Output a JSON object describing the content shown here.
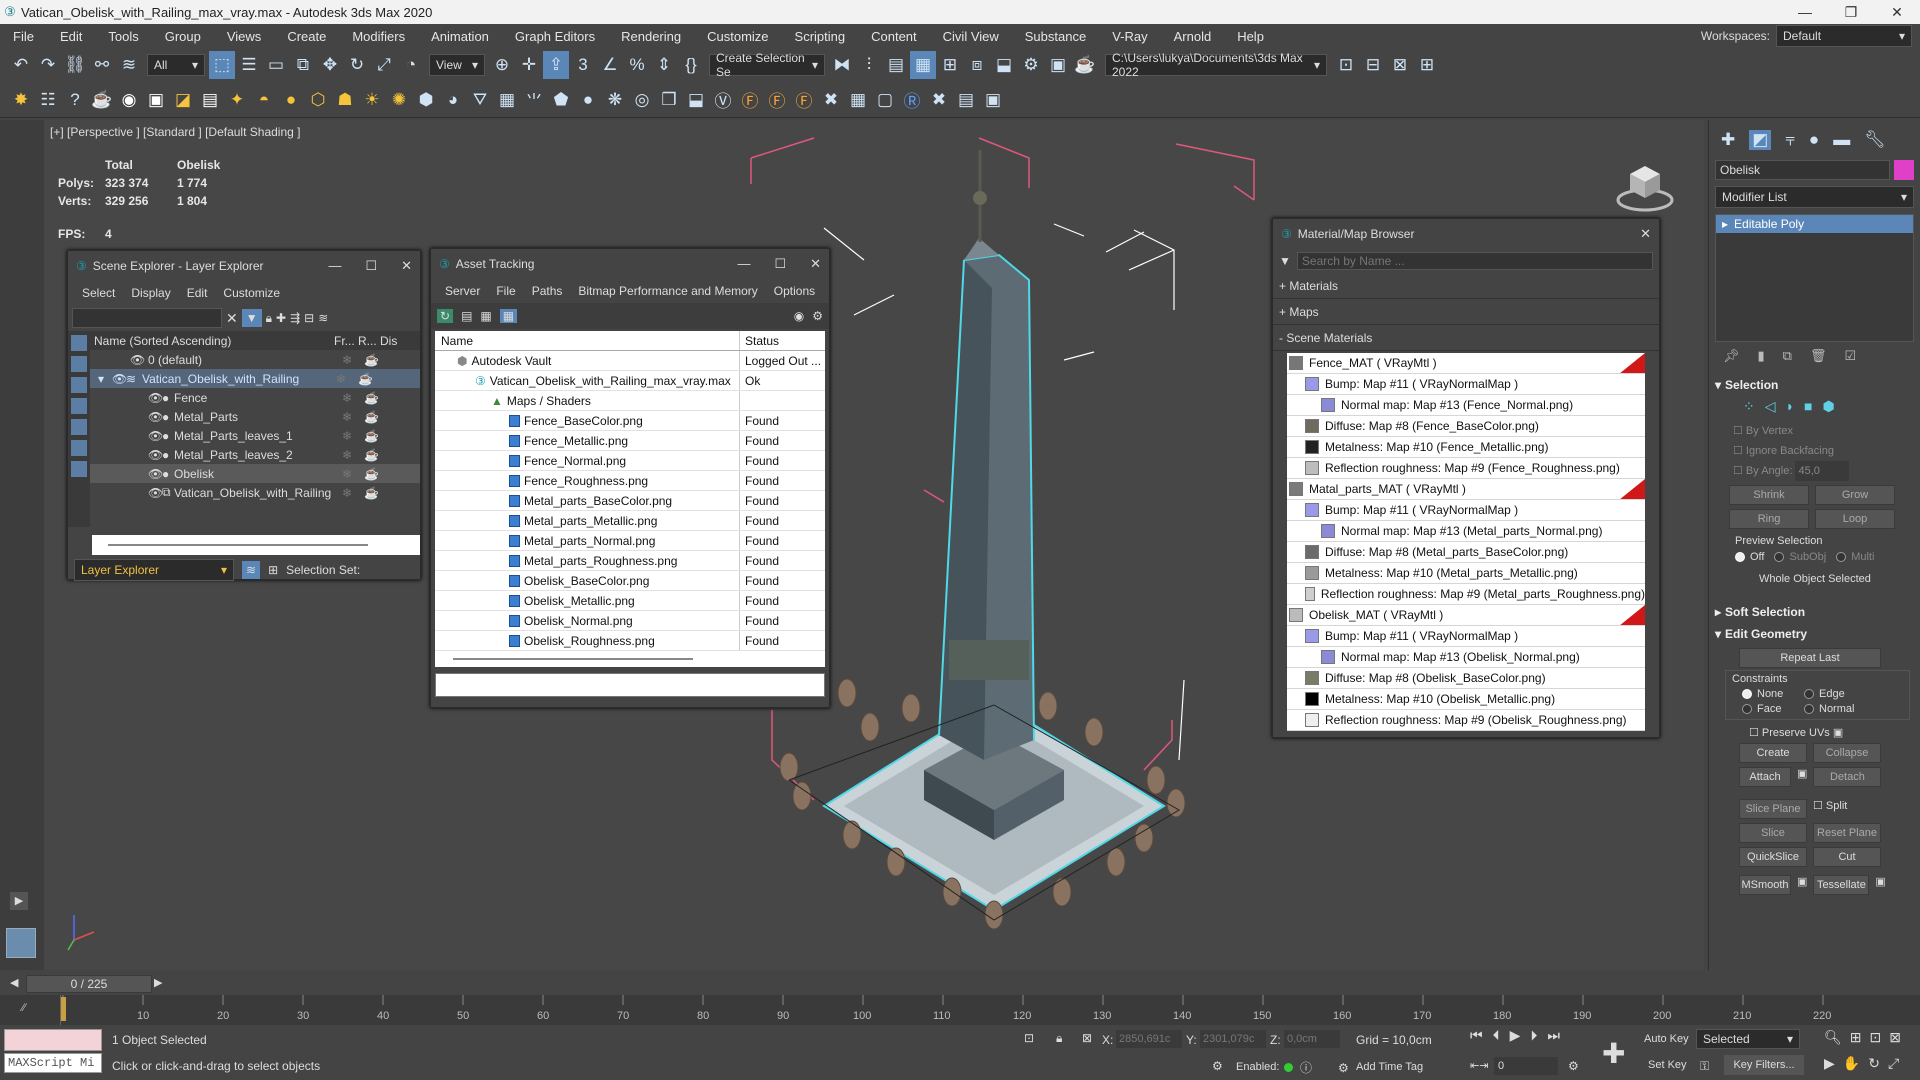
{
  "window": {
    "title": "Vatican_Obelisk_with_Railing_max_vray.max - Autodesk 3ds Max 2020",
    "workspace_label": "Workspaces:",
    "workspace_value": "Default"
  },
  "menu": [
    "File",
    "Edit",
    "Tools",
    "Group",
    "Views",
    "Create",
    "Modifiers",
    "Animation",
    "Graph Editors",
    "Rendering",
    "Customize",
    "Scripting",
    "Content",
    "Civil View",
    "Substance",
    "V-Ray",
    "Arnold",
    "Help"
  ],
  "toolbar": {
    "filter": "All",
    "ref_coord": "View",
    "selection_set": "Create Selection Se",
    "project_path": "C:\\Users\\lukya\\Documents\\3ds Max 2022"
  },
  "viewport": {
    "label": "[+] [Perspective ] [Standard ] [Default Shading ]",
    "stats": {
      "h_total": "Total",
      "h_obj": "Obelisk",
      "polys_label": "Polys:",
      "polys_total": "323 374",
      "polys_obj": "1 774",
      "verts_label": "Verts:",
      "verts_total": "329 256",
      "verts_obj": "1 804",
      "fps_label": "FPS:",
      "fps_value": "4"
    }
  },
  "scene_explorer": {
    "title": "Scene Explorer - Layer Explorer",
    "menu": [
      "Select",
      "Display",
      "Edit",
      "Customize"
    ],
    "col_name": "Name (Sorted Ascending)",
    "col_fr": "Fr...",
    "col_r": "R...",
    "col_dis": "Dis",
    "rows": [
      "0 (default)",
      "Vatican_Obelisk_with_Railing",
      "Fence",
      "Metal_Parts",
      "Metal_Parts_leaves_1",
      "Metal_Parts_leaves_2",
      "Obelisk",
      "Vatican_Obelisk_with_Railing"
    ],
    "footer_dropdown": "Layer Explorer",
    "selection_set_label": "Selection Set:"
  },
  "asset_tracking": {
    "title": "Asset Tracking",
    "menu": [
      "Server",
      "File",
      "Paths",
      "Bitmap Performance and Memory",
      "Options"
    ],
    "col_name": "Name",
    "col_status": "Status",
    "rows": [
      {
        "name": "Autodesk Vault",
        "status": "Logged Out ..."
      },
      {
        "name": "Vatican_Obelisk_with_Railing_max_vray.max",
        "status": "Ok"
      },
      {
        "name": "Maps / Shaders",
        "status": ""
      },
      {
        "name": "Fence_BaseColor.png",
        "status": "Found"
      },
      {
        "name": "Fence_Metallic.png",
        "status": "Found"
      },
      {
        "name": "Fence_Normal.png",
        "status": "Found"
      },
      {
        "name": "Fence_Roughness.png",
        "status": "Found"
      },
      {
        "name": "Metal_parts_BaseColor.png",
        "status": "Found"
      },
      {
        "name": "Metal_parts_Metallic.png",
        "status": "Found"
      },
      {
        "name": "Metal_parts_Normal.png",
        "status": "Found"
      },
      {
        "name": "Metal_parts_Roughness.png",
        "status": "Found"
      },
      {
        "name": "Obelisk_BaseColor.png",
        "status": "Found"
      },
      {
        "name": "Obelisk_Metallic.png",
        "status": "Found"
      },
      {
        "name": "Obelisk_Normal.png",
        "status": "Found"
      },
      {
        "name": "Obelisk_Roughness.png",
        "status": "Found"
      }
    ]
  },
  "material_browser": {
    "title": "Material/Map Browser",
    "search_placeholder": "Search by Name ...",
    "sec_materials": "+ Materials",
    "sec_maps": "+ Maps",
    "sec_scene": "- Scene Materials",
    "rows": [
      {
        "text": "Fence_MAT  ( VRayMtl )",
        "sw": "#888888"
      },
      {
        "text": "Bump: Map #11  ( VRayNormalMap )",
        "sw": "#9a9ae8"
      },
      {
        "text": "Normal map: Map #13 (Fence_Normal.png)",
        "sw": "#8a8ad8"
      },
      {
        "text": "Diffuse: Map #8 (Fence_BaseColor.png)",
        "sw": "#6f6a5e"
      },
      {
        "text": "Metalness: Map #10 (Fence_Metallic.png)",
        "sw": "#222222"
      },
      {
        "text": "Reflection roughness: Map #9 (Fence_Roughness.png)",
        "sw": "#bdbdbd"
      },
      {
        "text": "Matal_parts_MAT  ( VRayMtl )",
        "sw": "#7a7a7a"
      },
      {
        "text": "Bump: Map #11  ( VRayNormalMap )",
        "sw": "#9a9ae8"
      },
      {
        "text": "Normal map: Map #13 (Metal_parts_Normal.png)",
        "sw": "#8a8ad8"
      },
      {
        "text": "Diffuse: Map #8 (Metal_parts_BaseColor.png)",
        "sw": "#6a6a6a"
      },
      {
        "text": "Metalness: Map #10 (Metal_parts_Metallic.png)",
        "sw": "#9a9a9a"
      },
      {
        "text": "Reflection roughness: Map #9 (Metal_parts_Roughness.png)",
        "sw": "#cfcfcf"
      },
      {
        "text": "Obelisk_MAT  ( VRayMtl )",
        "sw": "#bbbbbb"
      },
      {
        "text": "Bump: Map #11  ( VRayNormalMap )",
        "sw": "#9a9ae8"
      },
      {
        "text": "Normal map: Map #13 (Obelisk_Normal.png)",
        "sw": "#8a8ad8"
      },
      {
        "text": "Diffuse: Map #8 (Obelisk_BaseColor.png)",
        "sw": "#7a7a6a"
      },
      {
        "text": "Metalness: Map #10 (Obelisk_Metallic.png)",
        "sw": "#000000"
      },
      {
        "text": "Reflection roughness: Map #9 (Obelisk_Roughness.png)",
        "sw": "#eeeeee"
      }
    ]
  },
  "command_panel": {
    "object_name": "Obelisk",
    "object_color": "#e040c8",
    "modifier_list": "Modifier List",
    "modifier": "Editable Poly",
    "selection_title": "Selection",
    "by_vertex": "By Vertex",
    "ignore_backfacing": "Ignore Backfacing",
    "by_angle": "By Angle:",
    "by_angle_value": "45,0",
    "shrink": "Shrink",
    "grow": "Grow",
    "ring": "Ring",
    "loop": "Loop",
    "preview_selection": "Preview Selection",
    "ps_off": "Off",
    "ps_subobj": "SubObj",
    "ps_multi": "Multi",
    "whole_object": "Whole Object Selected",
    "soft_selection": "Soft Selection",
    "edit_geometry": "Edit Geometry",
    "repeat_last": "Repeat Last",
    "constraints": "Constraints",
    "c_none": "None",
    "c_edge": "Edge",
    "c_face": "Face",
    "c_normal": "Normal",
    "preserve_uvs": "Preserve UVs",
    "create": "Create",
    "collapse": "Collapse",
    "attach": "Attach",
    "detach": "Detach",
    "slice_plane": "Slice Plane",
    "split": "Split",
    "slice": "Slice",
    "reset_plane": "Reset Plane",
    "quickslice": "QuickSlice",
    "cut": "Cut",
    "msmooth": "MSmooth",
    "tessellate": "Tessellate"
  },
  "timeline": {
    "frame": "0 / 225",
    "ticks": [
      "10",
      "20",
      "30",
      "40",
      "50",
      "60",
      "70",
      "80",
      "90",
      "100",
      "110",
      "120",
      "130",
      "140",
      "150",
      "160",
      "170",
      "180",
      "190",
      "200",
      "210",
      "220"
    ]
  },
  "status": {
    "maxscript": "MAXScript Mi",
    "selected": "1 Object Selected",
    "prompt": "Click or click-and-drag to select objects",
    "x_label": "X:",
    "x": "2850,691c",
    "y_label": "Y:",
    "y": "2301,079c",
    "z_label": "Z:",
    "z": "0,0cm",
    "grid": "Grid = 10,0cm",
    "enabled": "Enabled:",
    "add_time_tag": "Add Time Tag",
    "auto_key": "Auto Key",
    "set_key": "Set Key",
    "key_mode": "Selected",
    "key_filters": "Key Filters...",
    "frame_field": "0"
  }
}
